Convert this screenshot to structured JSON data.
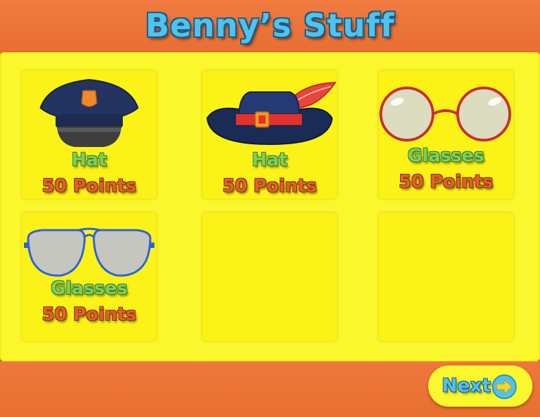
{
  "title": "Benny’s Stuff",
  "items": [
    {
      "name": "Hat",
      "points": "50 Points",
      "icon": "police-hat-icon"
    },
    {
      "name": "Hat",
      "points": "50 Points",
      "icon": "feathered-hat-icon"
    },
    {
      "name": "Glasses",
      "points": "50 Points",
      "icon": "round-glasses-icon"
    },
    {
      "name": "Glasses",
      "points": "50 Points",
      "icon": "aviator-glasses-icon"
    }
  ],
  "next_button": {
    "label": "Next",
    "icon": "arrow-right-icon"
  },
  "colors": {
    "header": "#ee773d",
    "panel": "#fbf72d",
    "title": "#4fc3ec",
    "item_name": "#7bd25b",
    "item_points": "#e0612a"
  }
}
